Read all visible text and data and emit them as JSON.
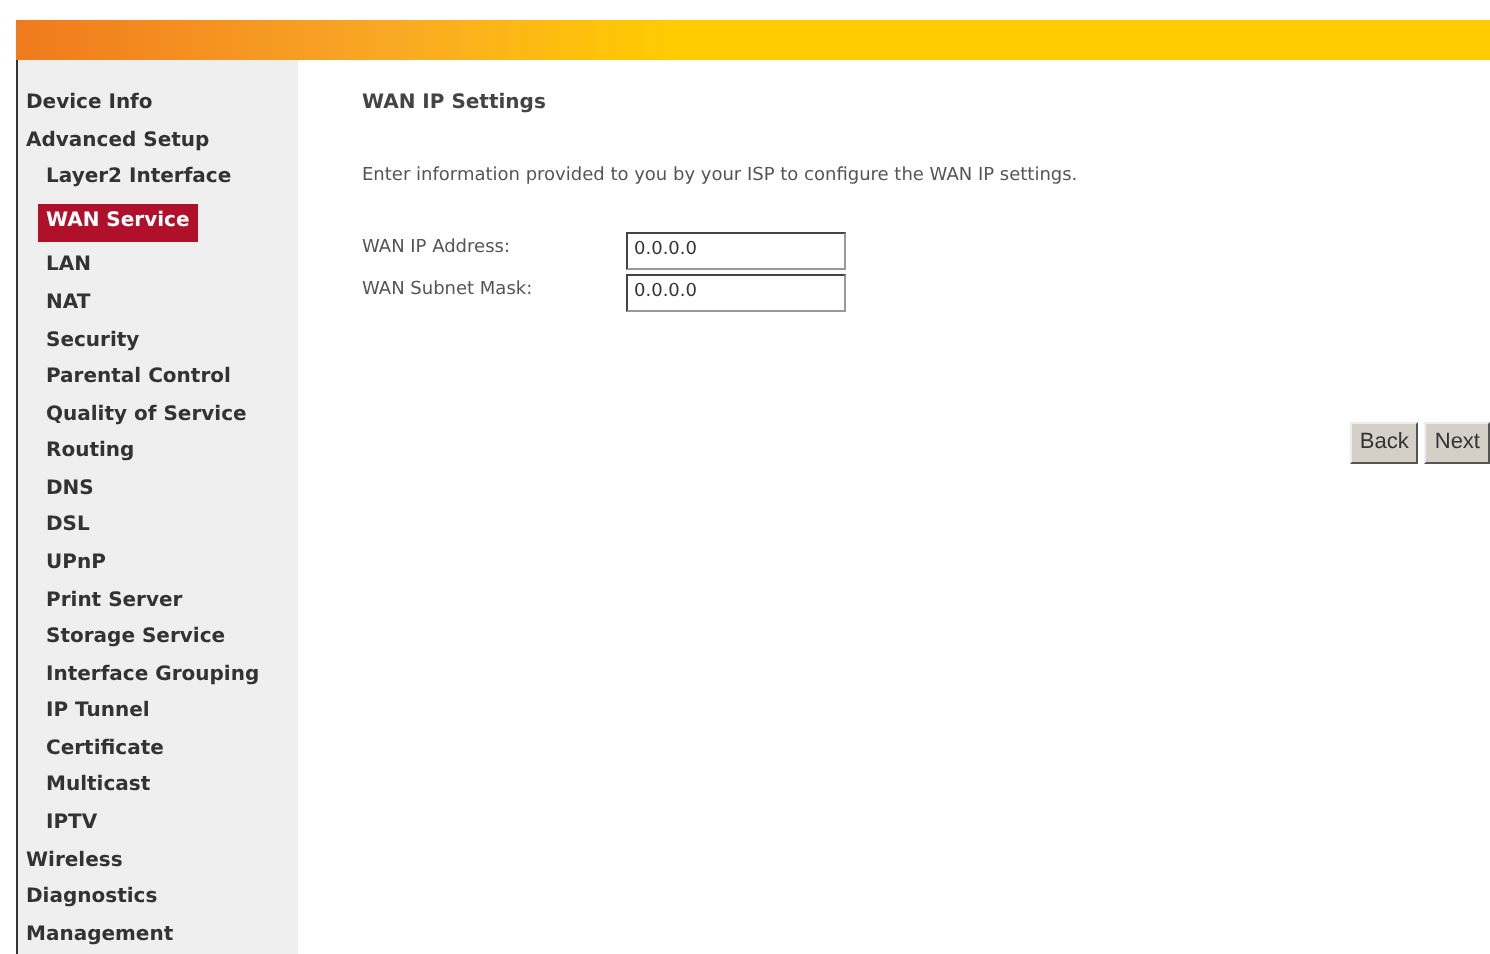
{
  "sidebar": {
    "items": [
      {
        "label": "Device Info",
        "selected": false
      },
      {
        "label": "Advanced Setup",
        "selected": false,
        "children": [
          {
            "label": "Layer2 Interface",
            "selected": false
          },
          {
            "label": "WAN Service",
            "selected": true
          },
          {
            "label": "LAN",
            "selected": false
          },
          {
            "label": "NAT",
            "selected": false
          },
          {
            "label": "Security",
            "selected": false
          },
          {
            "label": "Parental Control",
            "selected": false
          },
          {
            "label": "Quality of Service",
            "selected": false
          },
          {
            "label": "Routing",
            "selected": false
          },
          {
            "label": "DNS",
            "selected": false
          },
          {
            "label": "DSL",
            "selected": false
          },
          {
            "label": "UPnP",
            "selected": false
          },
          {
            "label": "Print Server",
            "selected": false
          },
          {
            "label": "Storage Service",
            "selected": false
          },
          {
            "label": "Interface Grouping",
            "selected": false
          },
          {
            "label": "IP Tunnel",
            "selected": false
          },
          {
            "label": "Certificate",
            "selected": false
          },
          {
            "label": "Multicast",
            "selected": false
          },
          {
            "label": "IPTV",
            "selected": false
          }
        ]
      },
      {
        "label": "Wireless",
        "selected": false
      },
      {
        "label": "Diagnostics",
        "selected": false
      },
      {
        "label": "Management",
        "selected": false
      }
    ]
  },
  "main": {
    "title": "WAN IP Settings",
    "description": "Enter information provided to you by your ISP to configure the WAN IP settings.",
    "fields": [
      {
        "label": "WAN IP Address:",
        "value": "0.0.0.0"
      },
      {
        "label": "WAN Subnet Mask:",
        "value": "0.0.0.0"
      }
    ],
    "buttons": [
      "Back",
      "Next"
    ]
  }
}
